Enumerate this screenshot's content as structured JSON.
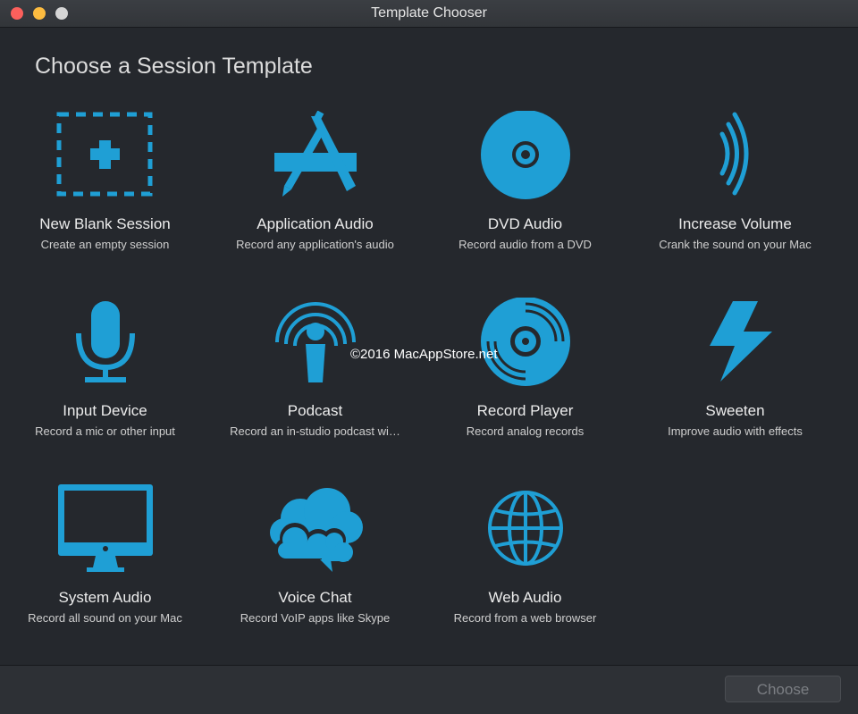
{
  "window": {
    "title": "Template Chooser"
  },
  "heading": "Choose a Session Template",
  "accent_color": "#1f9fd5",
  "templates": [
    {
      "name": "New Blank Session",
      "desc": "Create an empty session",
      "icon": "blank-session-icon"
    },
    {
      "name": "Application Audio",
      "desc": "Record any application's audio",
      "icon": "app-store-icon"
    },
    {
      "name": "DVD Audio",
      "desc": "Record audio from a DVD",
      "icon": "dvd-icon"
    },
    {
      "name": "Increase Volume",
      "desc": "Crank the sound on your Mac",
      "icon": "sound-waves-icon"
    },
    {
      "name": "Input Device",
      "desc": "Record a mic or other input",
      "icon": "microphone-icon"
    },
    {
      "name": "Podcast",
      "desc": "Record an in-studio podcast wi…",
      "icon": "podcast-icon"
    },
    {
      "name": "Record Player",
      "desc": "Record analog records",
      "icon": "vinyl-record-icon"
    },
    {
      "name": "Sweeten",
      "desc": "Improve audio with effects",
      "icon": "lightning-icon"
    },
    {
      "name": "System Audio",
      "desc": "Record all sound on your Mac",
      "icon": "imac-icon"
    },
    {
      "name": "Voice Chat",
      "desc": "Record VoIP apps like Skype",
      "icon": "chat-clouds-icon"
    },
    {
      "name": "Web Audio",
      "desc": "Record from a web browser",
      "icon": "globe-icon"
    }
  ],
  "watermark": "©2016 MacAppStore.net",
  "footer": {
    "choose_label": "Choose"
  }
}
